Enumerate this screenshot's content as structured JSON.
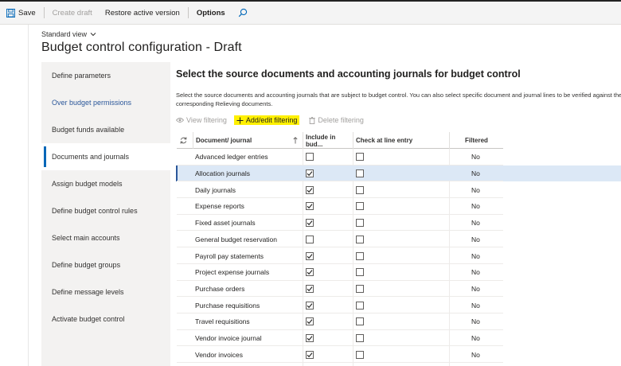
{
  "toolbar": {
    "save_label": "Save",
    "create_draft_label": "Create draft",
    "restore_label": "Restore active version",
    "options_label": "Options"
  },
  "header": {
    "view_selector": "Standard view",
    "page_title": "Budget control configuration - Draft"
  },
  "nav": {
    "items": [
      {
        "label": "Define parameters"
      },
      {
        "label": "Over budget permissions"
      },
      {
        "label": "Budget funds available"
      },
      {
        "label": "Documents and journals"
      },
      {
        "label": "Assign budget models"
      },
      {
        "label": "Define budget control rules"
      },
      {
        "label": "Select main accounts"
      },
      {
        "label": "Define budget groups"
      },
      {
        "label": "Define message levels"
      },
      {
        "label": "Activate budget control"
      }
    ]
  },
  "main": {
    "section_title": "Select the source documents and accounting journals for budget control",
    "description_line1": "Select the source documents and accounting journals that are subject to budget control. You can also select specific document and journal lines to be verified against the",
    "description_line2": "corresponding Relieving documents.",
    "actions": {
      "view_filtering": "View filtering",
      "add_edit_filtering": "Add/edit filtering",
      "delete_filtering": "Delete filtering"
    },
    "columns": {
      "document": "Document/ journal",
      "include": "Include in bud...",
      "check_line": "Check at line entry",
      "filtered": "Filtered"
    },
    "rows": [
      {
        "document": "Advanced ledger entries",
        "include": false,
        "check": false,
        "filtered": "No"
      },
      {
        "document": "Allocation journals",
        "include": true,
        "check": false,
        "filtered": "No"
      },
      {
        "document": "Daily journals",
        "include": true,
        "check": false,
        "filtered": "No"
      },
      {
        "document": "Expense reports",
        "include": true,
        "check": false,
        "filtered": "No"
      },
      {
        "document": "Fixed asset journals",
        "include": true,
        "check": false,
        "filtered": "No"
      },
      {
        "document": "General budget reservation",
        "include": false,
        "check": false,
        "filtered": "No"
      },
      {
        "document": "Payroll pay statements",
        "include": true,
        "check": false,
        "filtered": "No"
      },
      {
        "document": "Project expense journals",
        "include": true,
        "check": false,
        "filtered": "No"
      },
      {
        "document": "Purchase orders",
        "include": true,
        "check": false,
        "filtered": "No"
      },
      {
        "document": "Purchase requisitions",
        "include": true,
        "check": false,
        "filtered": "No"
      },
      {
        "document": "Travel requisitions",
        "include": true,
        "check": false,
        "filtered": "No"
      },
      {
        "document": "Vendor invoice journal",
        "include": true,
        "check": false,
        "filtered": "No"
      },
      {
        "document": "Vendor invoices",
        "include": true,
        "check": false,
        "filtered": "No"
      }
    ]
  }
}
